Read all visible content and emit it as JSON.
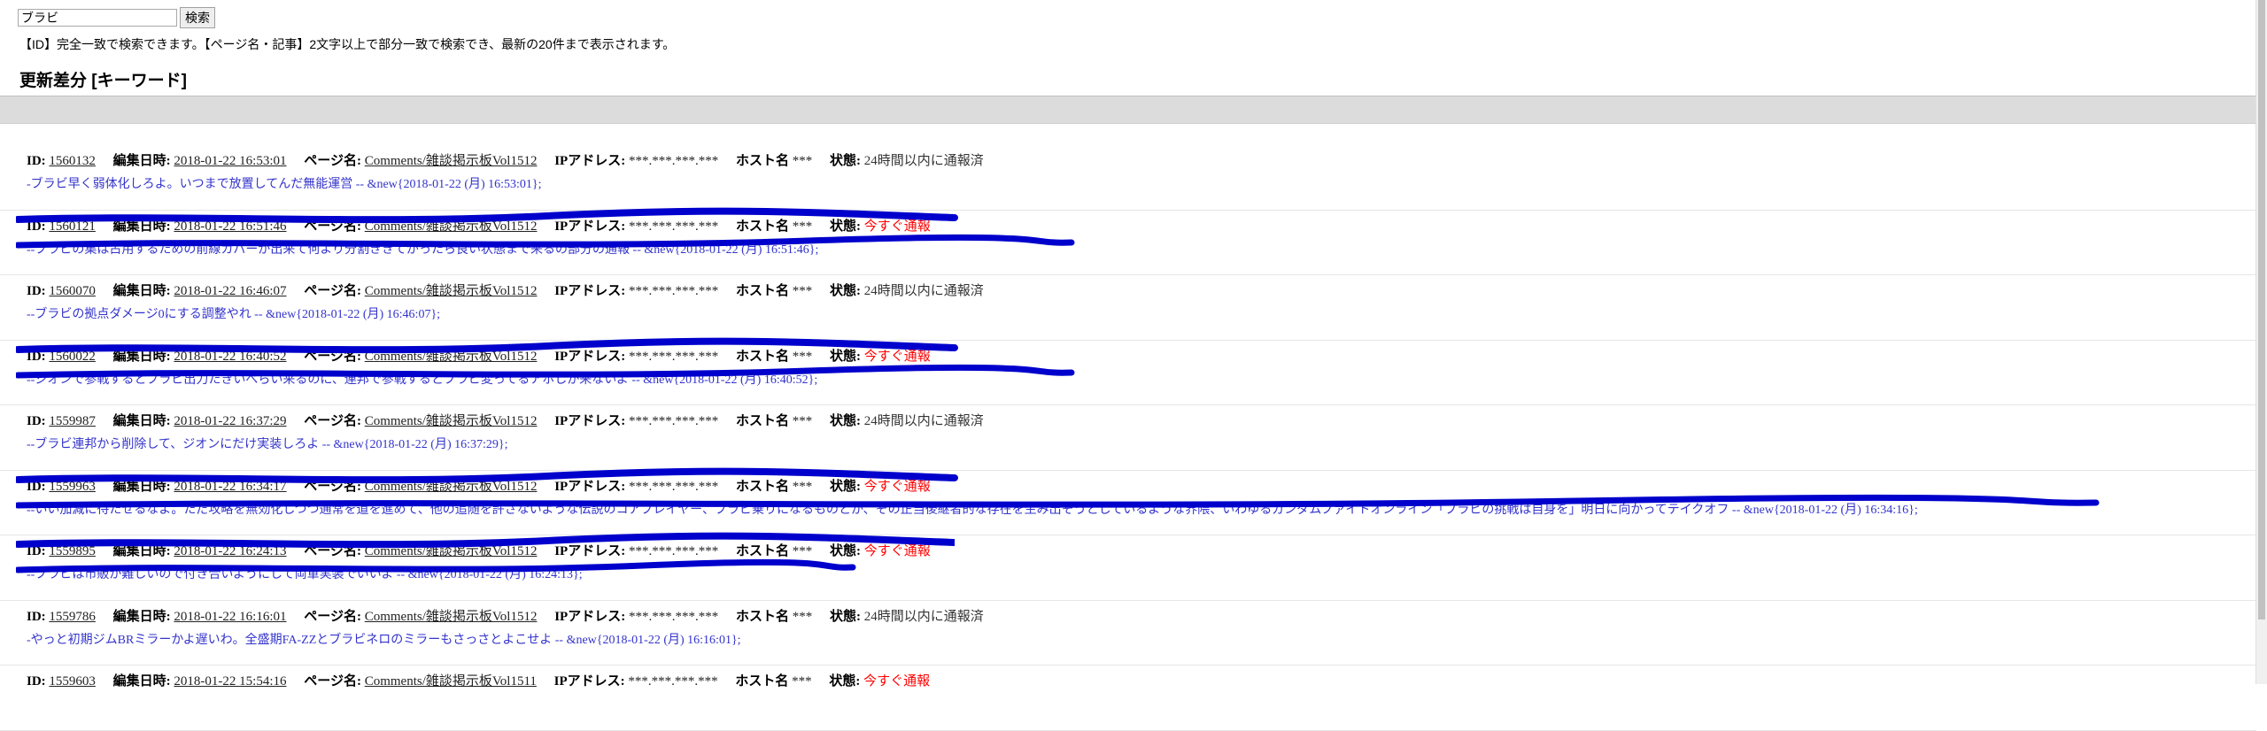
{
  "search": {
    "value": "ブラビ",
    "button": "検索"
  },
  "note": "【ID】完全一致で検索できます。【ページ名・記事】2文字以上で部分一致で検索でき、最新の20件まで表示されます。",
  "section": {
    "title": "更新差分",
    "link": "キーワード"
  },
  "labels": {
    "id": "ID:",
    "edited": "編集日時:",
    "page": "ページ名:",
    "ip": "IPアドレス:",
    "host": "ホスト名",
    "status": "状態:"
  },
  "entries": [
    {
      "id": "1560132",
      "date": "2018-01-22 16:53:01",
      "page": "Comments/雑談掲示板Vol1512",
      "ip": "***.***.***.***",
      "host": "***",
      "status": "24時間以内に通報済",
      "status_type": "ok",
      "body": "-ブラビ早く弱体化しろよ。いつまで放置してんだ無能運営 -- &new{2018-01-22 (月) 16:53:01};",
      "redacted": false
    },
    {
      "id": "1560121",
      "date": "2018-01-22 16:51:46",
      "page": "Comments/雑談掲示板Vol1512",
      "ip": "***.***.***.***",
      "host": "***",
      "status": "今すぐ通報",
      "status_type": "alert",
      "body": "--ブラビの集は占用するための前線カバーが出来て何より分割ききてがったら良い状態まで来るの部分の通報 -- &new{2018-01-22 (月) 16:51:46};",
      "redacted": true
    },
    {
      "id": "1560070",
      "date": "2018-01-22 16:46:07",
      "page": "Comments/雑談掲示板Vol1512",
      "ip": "***.***.***.***",
      "host": "***",
      "status": "24時間以内に通報済",
      "status_type": "ok",
      "body": "--ブラビの拠点ダメージ0にする調整やれ -- &new{2018-01-22 (月) 16:46:07};",
      "redacted": false
    },
    {
      "id": "1560022",
      "date": "2018-01-22 16:40:52",
      "page": "Comments/雑談掲示板Vol1512",
      "ip": "***.***.***.***",
      "host": "***",
      "status": "今すぐ通報",
      "status_type": "alert",
      "body": "--ジオンで参戦するとブラビ出力たきいべらい来るのに、連邦で参戦するとブラビ変ってるアホしか来ないよ -- &new{2018-01-22 (月) 16:40:52};",
      "redacted": true
    },
    {
      "id": "1559987",
      "date": "2018-01-22 16:37:29",
      "page": "Comments/雑談掲示板Vol1512",
      "ip": "***.***.***.***",
      "host": "***",
      "status": "24時間以内に通報済",
      "status_type": "ok",
      "body": "--ブラビ連邦から削除して、ジオンにだけ実装しろよ -- &new{2018-01-22 (月) 16:37:29};",
      "redacted": false
    },
    {
      "id": "1559963",
      "date": "2018-01-22 16:34:17",
      "page": "Comments/雑談掲示板Vol1512",
      "ip": "***.***.***.***",
      "host": "***",
      "status": "今すぐ通報",
      "status_type": "alert",
      "body": "--いい加減に待たせるなよ。ただ攻略を無効化しつつ通常を道を進めて、他の追随を許さないような伝説のコアプレイヤー、ブラビ乗りになるものとか、その正当後継者的な存在を生み出そうとしているような界隈、いわゆるガンダムファイトオンライン「ブラビの挑戦は自身を」明日に向かってテイクオフ -- &new{2018-01-22 (月) 16:34:16};",
      "redacted": true
    },
    {
      "id": "1559895",
      "date": "2018-01-22 16:24:13",
      "page": "Comments/雑談掲示板Vol1512",
      "ip": "***.***.***.***",
      "host": "***",
      "status": "今すぐ通報",
      "status_type": "alert",
      "body": "--ブラビは市販が難しいので付き合いようにして両軍実装でいいよ -- &new{2018-01-22 (月) 16:24:13};",
      "redacted": true
    },
    {
      "id": "1559786",
      "date": "2018-01-22 16:16:01",
      "page": "Comments/雑談掲示板Vol1512",
      "ip": "***.***.***.***",
      "host": "***",
      "status": "24時間以内に通報済",
      "status_type": "ok",
      "body": "-やっと初期ジムBRミラーかよ遅いわ。全盛期FA-ZZとブラビネロのミラーもさっさとよこせよ -- &new{2018-01-22 (月) 16:16:01};",
      "redacted": false
    },
    {
      "id": "1559603",
      "date": "2018-01-22 15:54:16",
      "page": "Comments/雑談掲示板Vol1511",
      "ip": "***.***.***.***",
      "host": "***",
      "status": "今すぐ通報",
      "status_type": "alert",
      "body": "",
      "redacted": false
    }
  ],
  "colors": {
    "body_text": "#3333cc",
    "alert": "#ff0000",
    "scribble": "#0000cc",
    "bar": "#dcdcdc"
  }
}
